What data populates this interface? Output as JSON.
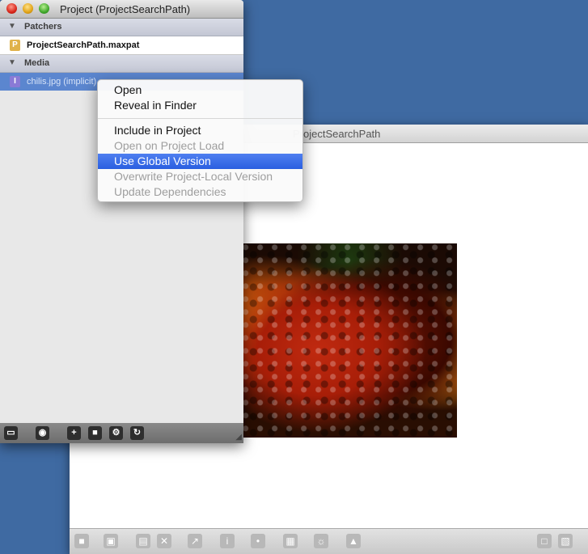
{
  "back_window": {
    "title": "ProjectSearchPath",
    "image_label": "chilis image"
  },
  "project_window": {
    "title": "Project (ProjectSearchPath)",
    "sections": [
      {
        "label": "Patchers",
        "items": [
          {
            "badge": "P",
            "name": "ProjectSearchPath.maxpat"
          }
        ]
      },
      {
        "label": "Media",
        "items": [
          {
            "badge": "I",
            "name": "chilis.jpg (implicit)"
          }
        ]
      }
    ],
    "bottom_toolbar": [
      "folder-icon",
      "eye-icon",
      "plus-icon",
      "package-icon",
      "gear-icon",
      "refresh-icon"
    ]
  },
  "context_menu": {
    "items": [
      {
        "label": "Open",
        "enabled": true
      },
      {
        "label": "Reveal in Finder",
        "enabled": true
      },
      {
        "label": "Include in Project",
        "enabled": true
      },
      {
        "label": "Open on Project Load",
        "enabled": false
      },
      {
        "label": "Use Global Version",
        "enabled": true,
        "highlighted": true
      },
      {
        "label": "Overwrite Project-Local Version",
        "enabled": false
      },
      {
        "label": "Update Dependencies",
        "enabled": false
      }
    ]
  },
  "colors": {
    "desktop": "#3f6aa2",
    "selection": "#5b86cf",
    "menu_highlight": "#2a5fe0"
  }
}
